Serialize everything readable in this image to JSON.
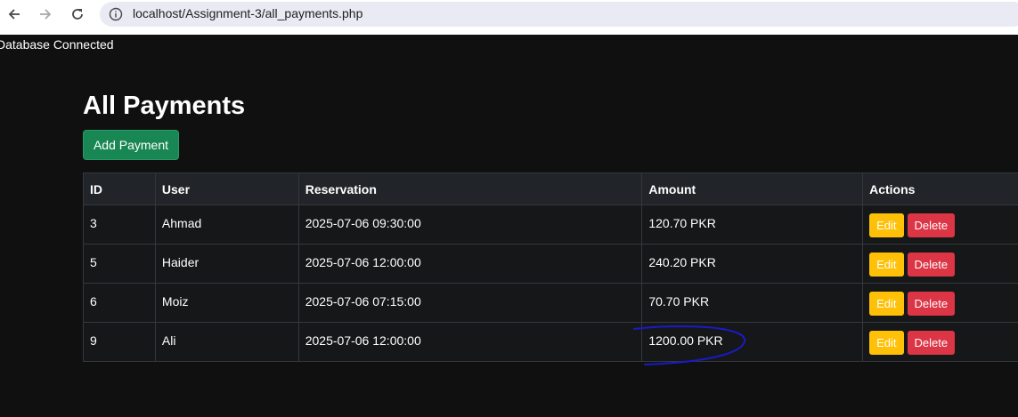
{
  "browser": {
    "url": "localhost/Assignment-3/all_payments.php"
  },
  "status_text": "Database Connected",
  "page": {
    "title": "All Payments",
    "add_button_label": "Add Payment"
  },
  "table": {
    "headers": [
      "ID",
      "User",
      "Reservation",
      "Amount",
      "Actions"
    ],
    "rows": [
      {
        "id": "3",
        "user": "Ahmad",
        "reservation": "2025-07-06 09:30:00",
        "amount": "120.70 PKR"
      },
      {
        "id": "5",
        "user": "Haider",
        "reservation": "2025-07-06 12:00:00",
        "amount": "240.20 PKR"
      },
      {
        "id": "6",
        "user": "Moiz",
        "reservation": "2025-07-06 07:15:00",
        "amount": "70.70 PKR"
      },
      {
        "id": "9",
        "user": "Ali",
        "reservation": "2025-07-06 12:00:00",
        "amount": "1200.00 PKR"
      }
    ],
    "edit_label": "Edit",
    "delete_label": "Delete"
  },
  "colors": {
    "background": "#101011",
    "success": "#198754",
    "warning": "#ffc107",
    "danger": "#dc3545",
    "annotation": "#1a1ac8"
  },
  "icons": {
    "back": "back-arrow-icon",
    "forward": "forward-arrow-icon",
    "reload": "reload-icon",
    "site_info": "info-icon"
  }
}
